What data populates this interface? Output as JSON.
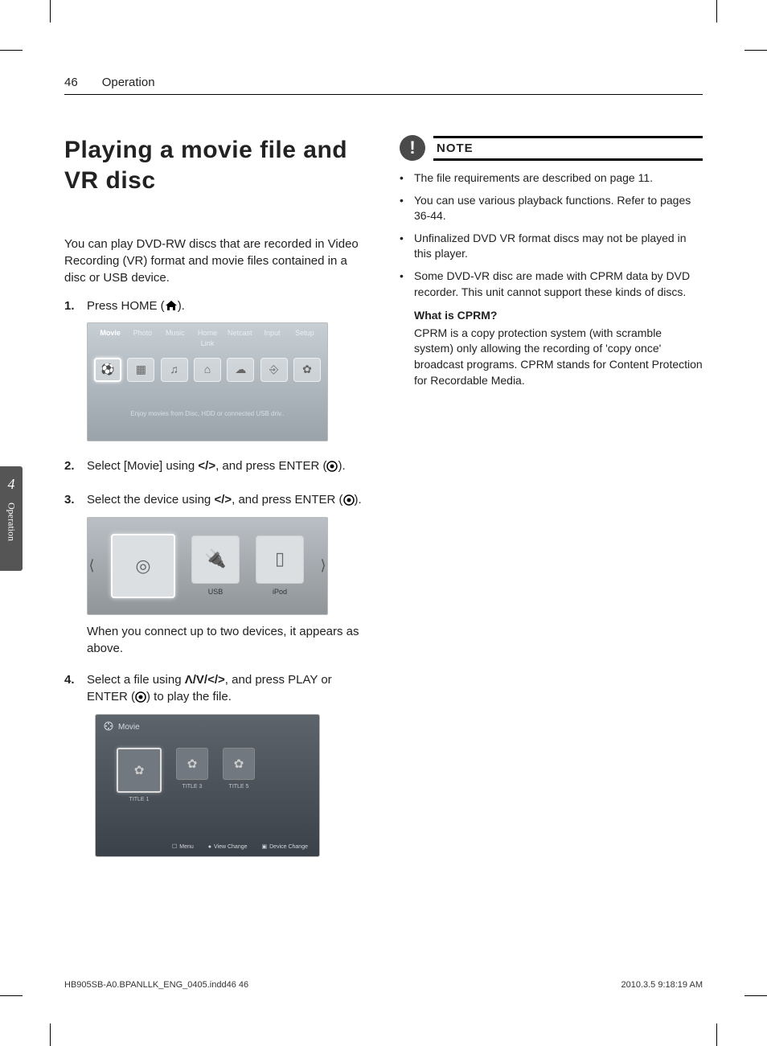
{
  "header": {
    "page_number": "46",
    "section": "Operation"
  },
  "side_tab": {
    "chapter_number": "4",
    "chapter_name": "Operation"
  },
  "title": "Playing a movie file and VR disc",
  "intro": "You can play DVD-RW discs that are recorded in Video Recording (VR) format and  movie files contained in a disc or USB device.",
  "steps": {
    "s1": {
      "num": "1.",
      "text_a": "Press HOME (",
      "text_b": ")."
    },
    "s2": {
      "num": "2.",
      "text_a": "Select [Movie] using ",
      "arrows": "</>",
      "text_b": ", and press ENTER (",
      "text_c": ")."
    },
    "s3": {
      "num": "3.",
      "text_a": "Select the device using ",
      "arrows": "</>",
      "text_b": ", and press ENTER (",
      "text_c": ").",
      "after": "When you connect up to two devices, it appears as above."
    },
    "s4": {
      "num": "4.",
      "text_a": "Select a file using ",
      "arrows": "Λ/V/</>",
      "text_b": ", and press PLAY or ENTER (",
      "text_c": ") to play the file."
    }
  },
  "ss1": {
    "tabs": [
      "Movie",
      "Photo",
      "Music",
      "Home Link",
      "Netcast",
      "Input",
      "Setup"
    ],
    "hint": "Enjoy movies from Disc, HDD or connected USB driv.."
  },
  "ss2": {
    "usb": "USB",
    "ipod": "iPod"
  },
  "ss3": {
    "title": "Movie",
    "titles": [
      "TITLE 1",
      "TITLE 3",
      "TITLE 5"
    ],
    "footer": {
      "menu": "Menu",
      "view": "View Change",
      "device": "Device Change"
    }
  },
  "note": {
    "label": "NOTE",
    "items": [
      "The file requirements are described on page 11.",
      "You can use various playback functions. Refer to pages 36-44.",
      "Unfinalized DVD VR format discs may not be played in this player.",
      "Some DVD-VR disc are made with CPRM data by DVD recorder. This unit cannot support these kinds of discs."
    ],
    "cprm_q": "What is CPRM?",
    "cprm_a": "CPRM is a copy protection system (with scramble system) only allowing the recording of 'copy once' broadcast programs. CPRM stands for Content Protection for Recordable Media."
  },
  "footer": {
    "left": "HB905SB-A0.BPANLLK_ENG_0405.indd46   46",
    "right": "2010.3.5   9:18:19 AM"
  }
}
